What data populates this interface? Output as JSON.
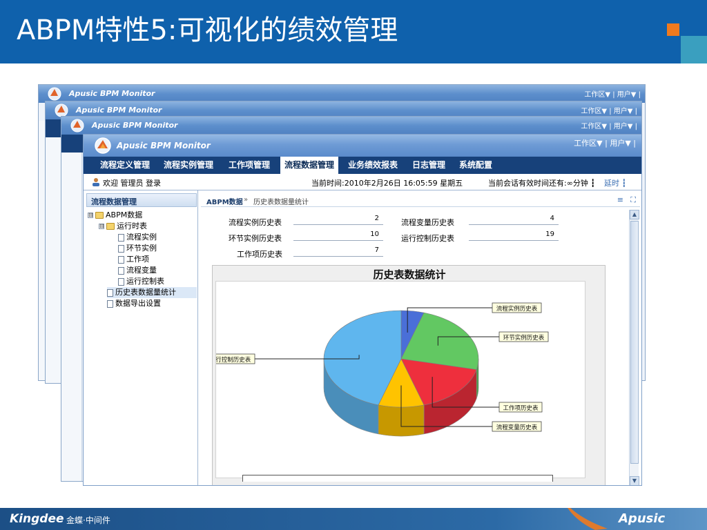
{
  "slide": {
    "title": "ABPM特性5:可视化的绩效管理",
    "footer_logo": "Kingdee",
    "footer_sub": "金蝶·中间件",
    "footer_brand": "Apusic",
    "colors": {
      "header": "#0f61ac",
      "accent_orange": "#f07a1e",
      "accent_teal": "#3a9fbf"
    }
  },
  "window": {
    "app_title": "Apusic BPM Monitor",
    "workspace_menu": "工作区▼ | 用户▼ |",
    "nav_tabs": [
      {
        "label": "流程定义管理"
      },
      {
        "label": "流程实例管理"
      },
      {
        "label": "工作项管理"
      },
      {
        "label": "流程数据管理",
        "active": true
      },
      {
        "label": "业务绩效报表"
      },
      {
        "label": "日志管理"
      },
      {
        "label": "系统配置"
      }
    ],
    "welcome": "欢迎 管理员 登录",
    "current_time": "当前时间:2010年2月26日 16:05:59 星期五",
    "session": "当前会话有效时间还有:∞分钟 ┇",
    "extend": "延时 ┇"
  },
  "left_panel": {
    "header": "流程数据管理",
    "tree": [
      {
        "label": "ABPM数据",
        "type": "folder",
        "toggle": "⊟"
      },
      {
        "label": "运行时表",
        "type": "folder",
        "toggle": "⊟"
      },
      {
        "label": "流程实例",
        "type": "doc"
      },
      {
        "label": "环节实例",
        "type": "doc"
      },
      {
        "label": "工作项",
        "type": "doc"
      },
      {
        "label": "流程变量",
        "type": "doc"
      },
      {
        "label": "运行控制表",
        "type": "doc"
      },
      {
        "label": "历史表数据量统计",
        "type": "doc",
        "selected": true
      },
      {
        "label": "数据导出设置",
        "type": "doc"
      }
    ]
  },
  "breadcrumb": {
    "root": "ABPM数据",
    "separator": "»",
    "current": "历史表数据量统计",
    "menu_icon": "≡",
    "maximize_icon": "⛶"
  },
  "stats": [
    {
      "label": "流程实例历史表",
      "value": "2"
    },
    {
      "label": "流程变量历史表",
      "value": "4"
    },
    {
      "label": "环节实例历史表",
      "value": "10"
    },
    {
      "label": "运行控制历史表",
      "value": "19"
    },
    {
      "label": "工作项历史表",
      "value": "7"
    }
  ],
  "chart_data": {
    "type": "pie",
    "title": "历史表数据统计",
    "three_d": true,
    "slices": [
      {
        "name": "流程实例历史表",
        "value": 2,
        "color": "#4a6fd8"
      },
      {
        "name": "环节实例历史表",
        "value": 10,
        "color": "#62c862"
      },
      {
        "name": "工作项历史表",
        "value": 7,
        "color": "#ee2f3d"
      },
      {
        "name": "流程变量历史表",
        "value": 4,
        "color": "#ffc300"
      },
      {
        "name": "运行控制历史表",
        "value": 19,
        "color": "#5fb6ee"
      }
    ]
  }
}
